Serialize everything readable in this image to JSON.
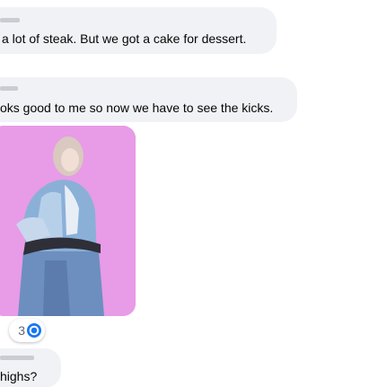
{
  "messages": [
    {
      "text": "a lot of steak. But we got a cake for dessert."
    },
    {
      "text": "oks good to me so now we have to see the kicks."
    },
    {
      "text": "highs?"
    }
  ],
  "photo": {
    "background_color": "#e89be6"
  },
  "reaction": {
    "count": "3",
    "icon": "reaction-icon"
  }
}
